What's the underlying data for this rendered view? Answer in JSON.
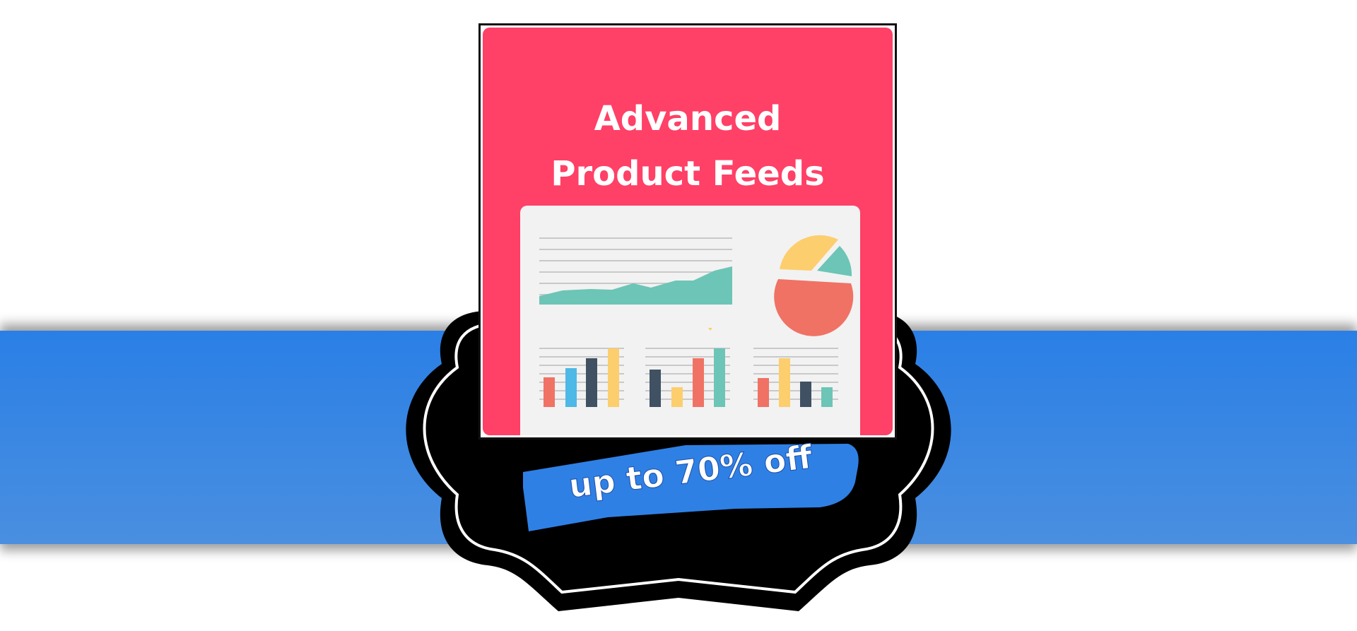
{
  "card": {
    "title_line1": "Advanced",
    "title_line2": "Product Feeds",
    "illustration": "dashboard-analytics-illustration"
  },
  "promo": {
    "label": "up to 70% off"
  },
  "colors": {
    "band_blue": "#2a7fe6",
    "card_pink": "#ff4067",
    "badge_black": "#000000",
    "ribbon_blue": "#2f80e4",
    "chart_teal": "#6cc5b6",
    "chart_yellow": "#fdce6d",
    "chart_red": "#f07264",
    "chart_cyan": "#4eb8e6",
    "chart_navy": "#3f5162"
  }
}
